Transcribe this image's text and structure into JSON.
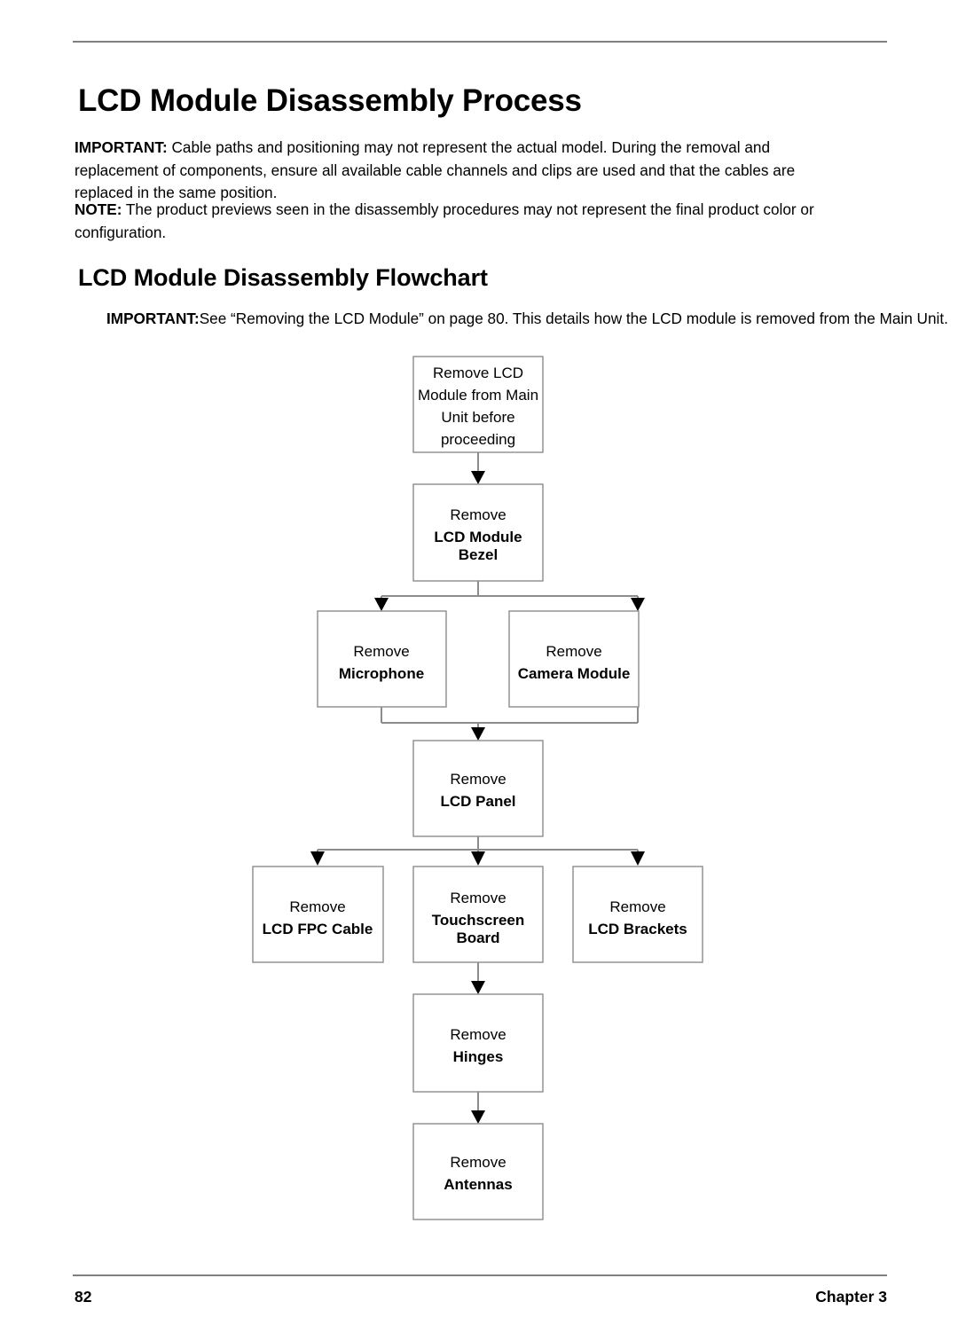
{
  "document": {
    "page_title": "LCD Module Disassembly Process",
    "section_title": "LCD Module Disassembly Flowchart"
  },
  "notices": {
    "important_label": "IMPORTANT:",
    "important_text": " Cable paths and positioning may not represent the actual model. During the removal and replacement of components, ensure all available cable channels and clips are used and that the cables are replaced in the same position.",
    "note_label": "NOTE:",
    "note_text": " The product previews seen in the disassembly procedures may not represent the final product color or configuration.",
    "flow_important_label": "IMPORTANT:",
    "flow_important_text": "See “Removing the LCD Module” on page 80. This details how the LCD module is removed from the Main Unit."
  },
  "flowchart": {
    "nodes": [
      {
        "id": "start",
        "lines": [
          "Remove LCD",
          "Module from Main",
          "Unit before",
          "proceeding"
        ],
        "bold": [
          false,
          false,
          false,
          false
        ]
      },
      {
        "id": "bezel",
        "lines": [
          "Remove",
          "LCD Module",
          "Bezel"
        ],
        "bold": [
          false,
          true,
          true
        ]
      },
      {
        "id": "microphone",
        "lines": [
          "Remove",
          "Microphone"
        ],
        "bold": [
          false,
          true
        ]
      },
      {
        "id": "camera",
        "lines": [
          "Remove",
          "Camera Module"
        ],
        "bold": [
          false,
          true
        ]
      },
      {
        "id": "lcd-panel",
        "lines": [
          "Remove",
          "LCD Panel"
        ],
        "bold": [
          false,
          true
        ]
      },
      {
        "id": "fpc-cable",
        "lines": [
          "Remove",
          "LCD FPC Cable"
        ],
        "bold": [
          false,
          true
        ]
      },
      {
        "id": "touchscreen",
        "lines": [
          "Remove",
          "Touchscreen",
          "Board"
        ],
        "bold": [
          false,
          true,
          true
        ]
      },
      {
        "id": "brackets",
        "lines": [
          "Remove",
          "LCD Brackets"
        ],
        "bold": [
          false,
          true
        ]
      },
      {
        "id": "hinges",
        "lines": [
          "Remove",
          "Hinges"
        ],
        "bold": [
          false,
          true
        ]
      },
      {
        "id": "antennas",
        "lines": [
          "Remove",
          "Antennas"
        ],
        "bold": [
          false,
          true
        ]
      }
    ],
    "colors": {
      "box_border": "#8c8c8c",
      "connector": "#8c8c8c",
      "arrow": "#000000",
      "box_fill": "#ffffff"
    }
  },
  "footer": {
    "page_number": "82",
    "chapter": "Chapter 3"
  }
}
